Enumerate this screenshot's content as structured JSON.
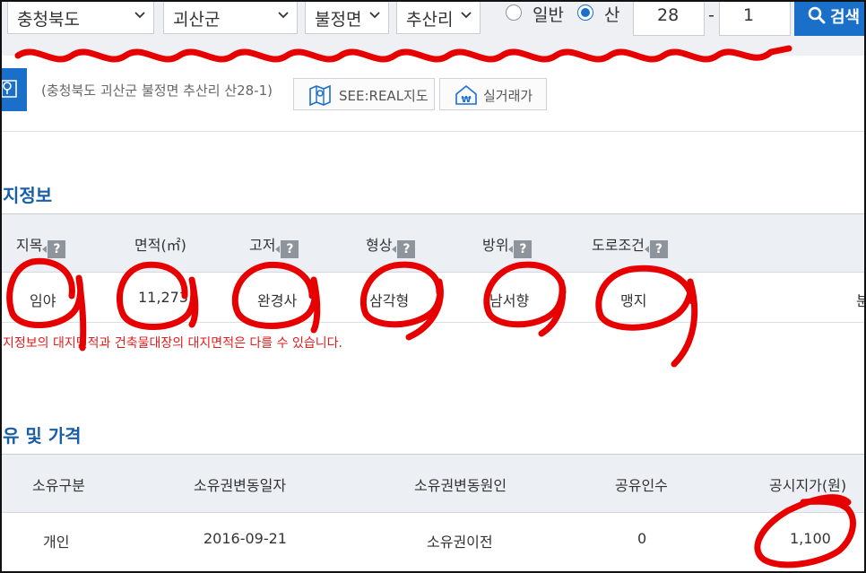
{
  "search": {
    "province": "충청북도",
    "county": "괴산군",
    "town": "불정면",
    "village": "추산리",
    "radio_general": "일반",
    "radio_mountain": "산",
    "lot_main": "28",
    "separator": "-",
    "lot_sub": "1",
    "search_button": "검색"
  },
  "address": {
    "text": "(충청북도 괴산군 불정면 추산리 산28-1)",
    "seereal_button": "SEE:REAL지도",
    "trade_button": "실거래가"
  },
  "land_info": {
    "title": "지정보",
    "headers": [
      "지목",
      "면적(㎡)",
      "고저",
      "형상",
      "방위",
      "도로조건"
    ],
    "values": [
      "임야",
      "11,273",
      "완경사",
      "삼각형",
      "남서향",
      "맹지"
    ],
    "cut_off_value": "분",
    "note": "지정보의 대지면적과 건축물대장의 대지면적은 다를 수 있습니다."
  },
  "ownership": {
    "title": "유 및 가격",
    "headers": [
      "소유구분",
      "소유권변동일자",
      "소유권변동원인",
      "공유인수",
      "공시지가(원)"
    ],
    "row": [
      "개인",
      "2016-09-21",
      "소유권이전",
      "0",
      "1,100"
    ]
  },
  "colors": {
    "accent": "#1a6fc9",
    "section_title": "#1a5ea8",
    "header_bg": "#eceff3",
    "note_red": "#e21c1c",
    "annotation_red": "#e60000"
  }
}
